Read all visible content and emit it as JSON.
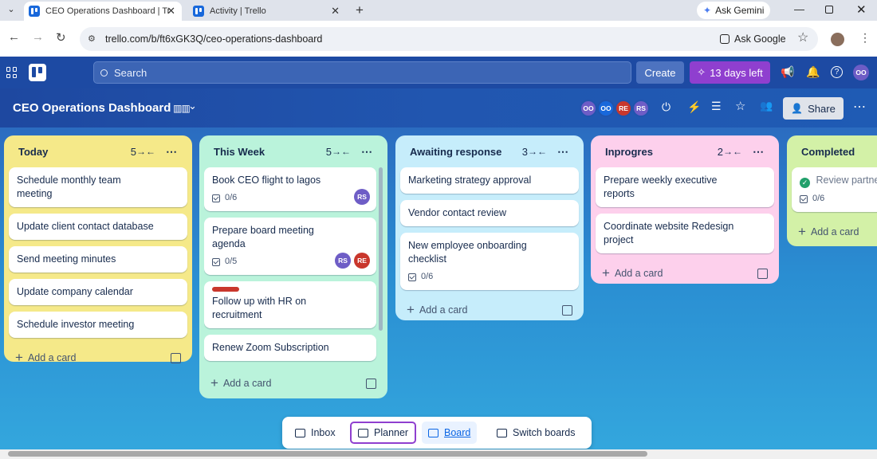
{
  "browser": {
    "tabs": [
      {
        "title": "CEO Operations Dashboard | Tr",
        "active": true
      },
      {
        "title": "Activity | Trello",
        "active": false
      }
    ],
    "new_tab_label": "+",
    "ask_gemini": "Ask Gemini",
    "url": "trello.com/b/ft6xGK3Q/ceo-operations-dashboard",
    "ask_google": "Ask Google"
  },
  "topbar": {
    "search_placeholder": "Search",
    "create_label": "Create",
    "trial_label": "13 days left",
    "user_initials": "OO"
  },
  "board": {
    "title": "CEO Operations Dashboard",
    "members": [
      {
        "initials": "OO",
        "color": "#6e5dc6"
      },
      {
        "initials": "OO",
        "color": "#1868db"
      },
      {
        "initials": "RE",
        "color": "#c9372c"
      },
      {
        "initials": "RS",
        "color": "#6e5dc6"
      }
    ],
    "share_label": "Share"
  },
  "lists": [
    {
      "name": "Today",
      "count": "5",
      "color": "#f5e989",
      "cards": [
        {
          "title": "Schedule monthly team meeting"
        },
        {
          "title": "Update client contact database"
        },
        {
          "title": "Send meeting minutes"
        },
        {
          "title": "Update company calendar"
        },
        {
          "title": "Schedule investor meeting"
        }
      ]
    },
    {
      "name": "This Week",
      "count": "5",
      "color": "#baf3db",
      "cards": [
        {
          "title": "Book CEO flight to lagos",
          "checklist": "0/6",
          "members": [
            "RS"
          ]
        },
        {
          "title": "Prepare board meeting agenda",
          "checklist": "0/5",
          "members": [
            "RS",
            "RE"
          ]
        },
        {
          "title": "Follow up with HR on recruitment",
          "label_color": "#c9372c"
        },
        {
          "title": "Renew Zoom Subscription"
        }
      ]
    },
    {
      "name": "Awaiting response",
      "count": "3",
      "color": "#c6edfb",
      "cards": [
        {
          "title": "Marketing strategy approval"
        },
        {
          "title": "Vendor contact review"
        },
        {
          "title": "New employee onboarding checklist",
          "checklist": "0/6"
        }
      ]
    },
    {
      "name": "Inprogres",
      "count": "2",
      "color": "#fdd0ec",
      "cards": [
        {
          "title": "Prepare weekly executive reports"
        },
        {
          "title": "Coordinate website Redesign project"
        }
      ]
    },
    {
      "name": "Completed",
      "count": "",
      "color": "#d3f1a7",
      "cards": [
        {
          "title": "Review partne",
          "checklist": "0/6",
          "done": true
        }
      ]
    }
  ],
  "add_card_label": "Add a card",
  "bottom_nav": {
    "inbox": "Inbox",
    "planner": "Planner",
    "board": "Board",
    "switch": "Switch boards"
  },
  "colors": {
    "trello_blue": "#1868db",
    "trial_purple": "#8f3fcf",
    "member_rs": "#6e5dc6",
    "member_re": "#c9372c"
  }
}
